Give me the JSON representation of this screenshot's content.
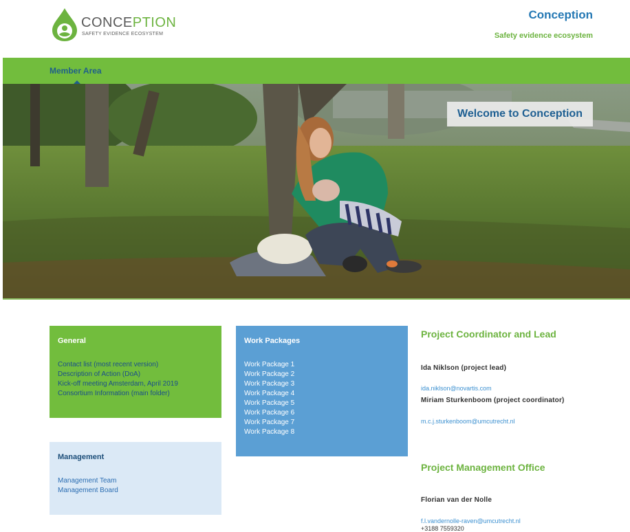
{
  "header": {
    "logo_word_main": "CONCE",
    "logo_word_accent": "PTION",
    "logo_sub": "SAFETY EVIDENCE ECOSYSTEM",
    "title": "Conception",
    "tagline": "Safety evidence ecosystem"
  },
  "nav": {
    "items": [
      {
        "label": "Member Area"
      }
    ]
  },
  "hero": {
    "welcome": "Welcome to Conception"
  },
  "general": {
    "title": "General",
    "links": [
      "Contact list (most recent version)",
      "Description of Action (DoA)",
      "Kick-off meeting Amsterdam, April 2019",
      "Consortium Information (main folder)"
    ]
  },
  "work_packages": {
    "title": "Work Packages",
    "links": [
      "Work Package 1",
      "Work Package 2",
      "Work Package 3",
      "Work Package 4",
      "Work Package 5",
      "Work Package 6",
      "Work Package 7",
      "Work Package 8"
    ]
  },
  "management": {
    "title": "Management",
    "links": [
      "Management Team",
      "Management Board"
    ]
  },
  "coordinator": {
    "heading": "Project Coordinator and Lead",
    "people": [
      {
        "name": "Ida Niklson (project lead)",
        "email": "ida.niklson@novartis.com"
      },
      {
        "name": "Miriam Sturkenboom (project coordinator)",
        "email": "m.c.j.sturkenboom@umcutrecht.nl"
      }
    ]
  },
  "pmo": {
    "heading": "Project Management Office",
    "people": [
      {
        "name": "Florian van der Nolle",
        "email": "f.l.vandernolle-raven@umcutrecht.nl",
        "phone": "+3188 7559320"
      }
    ]
  },
  "colors": {
    "brand_green": "#72bd3d",
    "brand_blue": "#2478b4",
    "wp_blue": "#5b9fd4",
    "mgmt_light": "#dbe9f6"
  }
}
